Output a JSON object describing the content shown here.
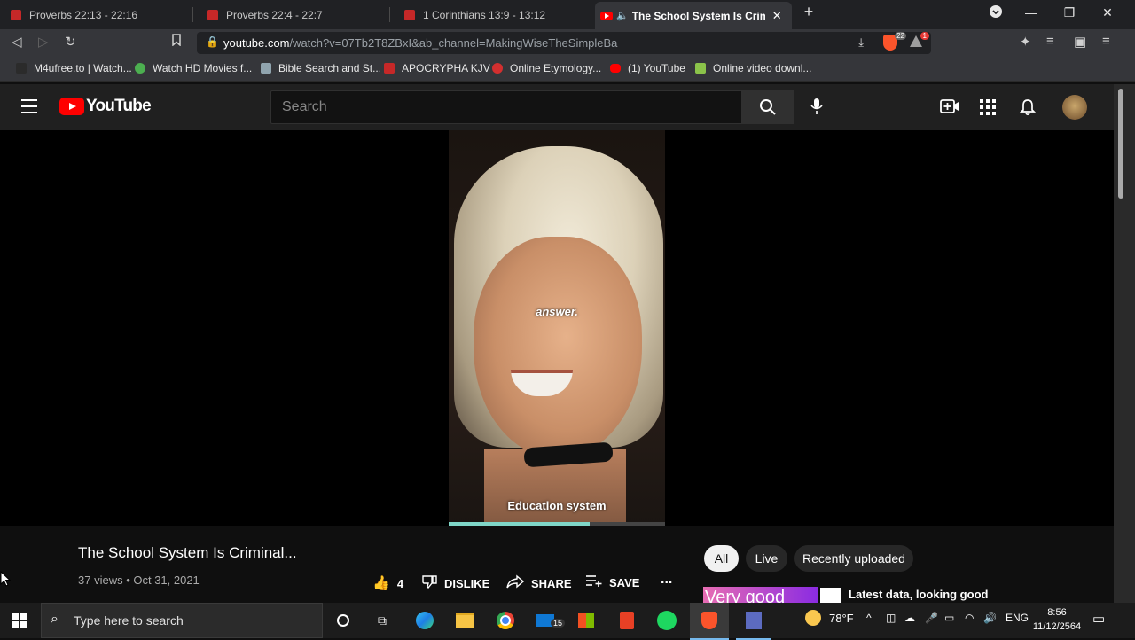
{
  "browser": {
    "tabs": [
      {
        "title": "Proverbs 22:13 - 22:16"
      },
      {
        "title": "Proverbs 22:4 - 22:7"
      },
      {
        "title": "1 Corinthians 13:9 - 13:12"
      },
      {
        "title": "The School System Is Criminal..."
      }
    ],
    "new_tab_symbol": "+",
    "url_host": "youtube.com",
    "url_path": "/watch?v=07Tb2T8ZBxI&ab_channel=MakingWiseTheSimpleBa",
    "shield_count": "22",
    "alert_count": "1",
    "bookmarks": [
      {
        "label": "M4ufree.to | Watch...",
        "color": "#2b2b2b"
      },
      {
        "label": "Watch HD Movies f...",
        "color": "#4caf50"
      },
      {
        "label": "Bible Search and St...",
        "color": "#90a4ae"
      },
      {
        "label": "APOCRYPHA KJV",
        "color": "#c62828"
      },
      {
        "label": "Online Etymology...",
        "color": "#d32f2f"
      },
      {
        "label": "(1) YouTube",
        "color": "#ff0000"
      },
      {
        "label": "Online video downl...",
        "color": "#8bc34a"
      }
    ]
  },
  "youtube": {
    "logo_text": "YouTube",
    "search_placeholder": "Search",
    "video": {
      "caption_top": "answer.",
      "caption_bottom": "Education system",
      "progress_fraction": 0.65
    },
    "title": "The School System Is Criminal...",
    "meta": "37 views • Oct 31, 2021",
    "actions": {
      "likes": "4",
      "dislike": "DISLIKE",
      "share": "SHARE",
      "save": "SAVE",
      "more": "..."
    },
    "chips": [
      "All",
      "Live",
      "Recently uploaded"
    ],
    "recommended": {
      "thumb_text": "Very good",
      "title": "Latest data, looking good"
    }
  },
  "taskbar": {
    "search_placeholder": "Type here to search",
    "mail_badge": "15",
    "weather": "78°F",
    "language": "ENG",
    "time": "8:56",
    "date": "11/12/2564"
  }
}
